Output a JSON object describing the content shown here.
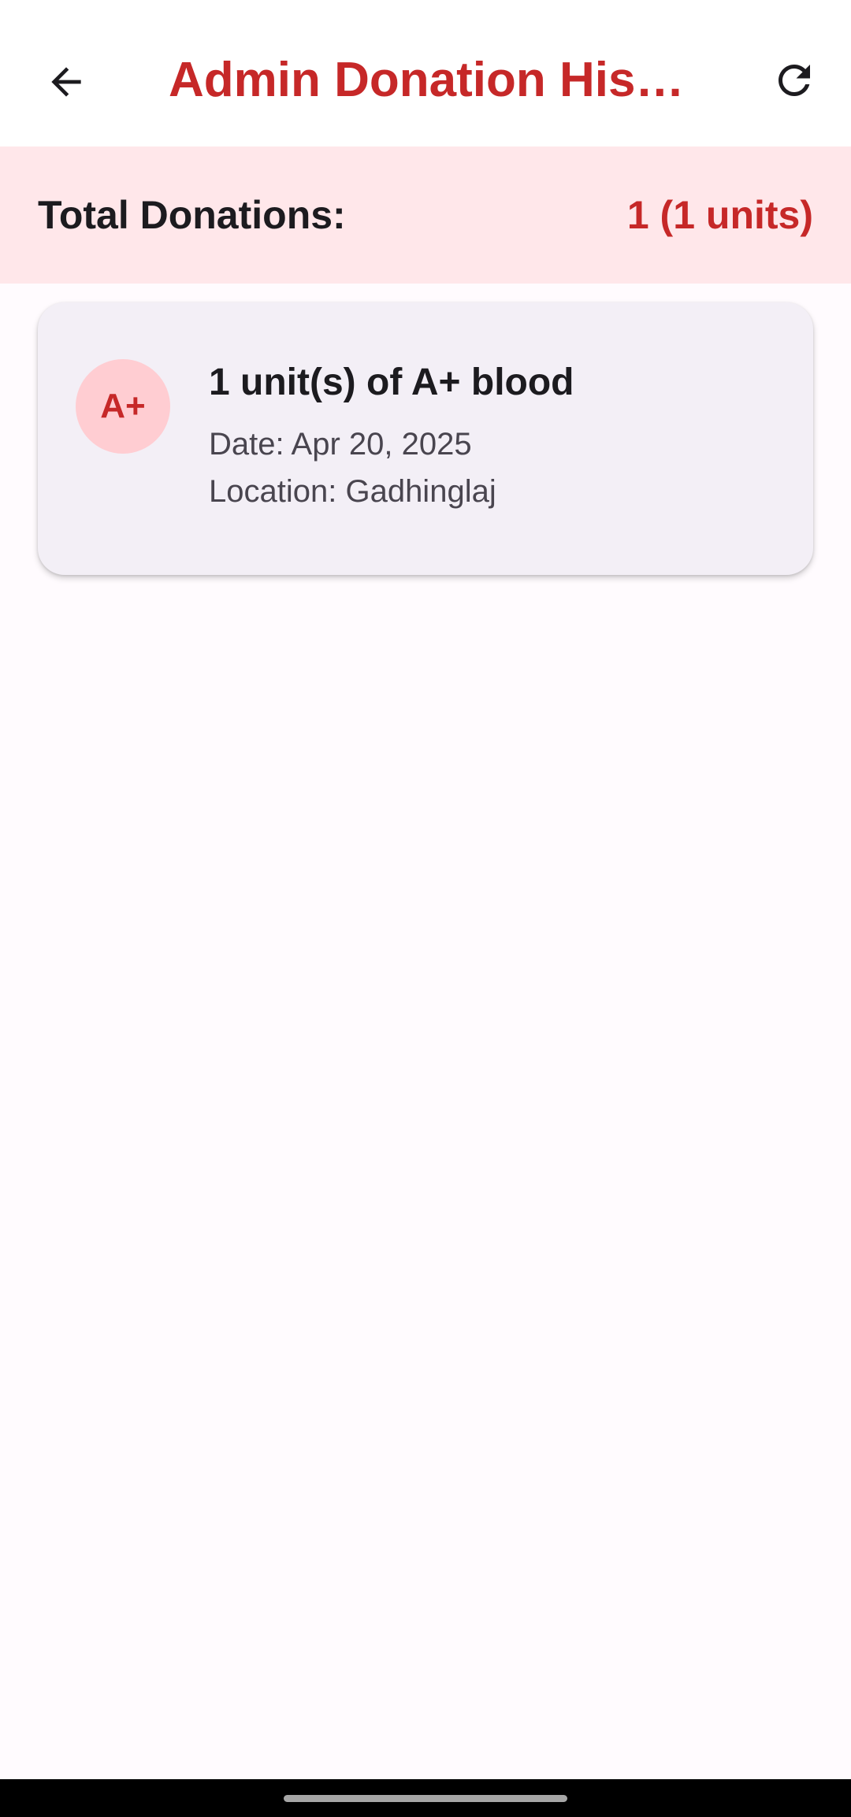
{
  "app_bar": {
    "title": "Admin Donation Hist…",
    "back_icon": "arrow-back-icon",
    "refresh_icon": "refresh-icon"
  },
  "summary": {
    "label": "Total Donations:",
    "value": "1 (1 units)"
  },
  "donations": [
    {
      "blood_group": "A+",
      "title": "1 unit(s) of A+ blood",
      "date": "Date: Apr 20, 2025",
      "location": "Location: Gadhinglaj"
    }
  ],
  "colors": {
    "accent": "#c62828",
    "summary_bg": "#ffe7ea",
    "card_bg": "#f3eff6",
    "avatar_bg": "#ffcdd2"
  }
}
